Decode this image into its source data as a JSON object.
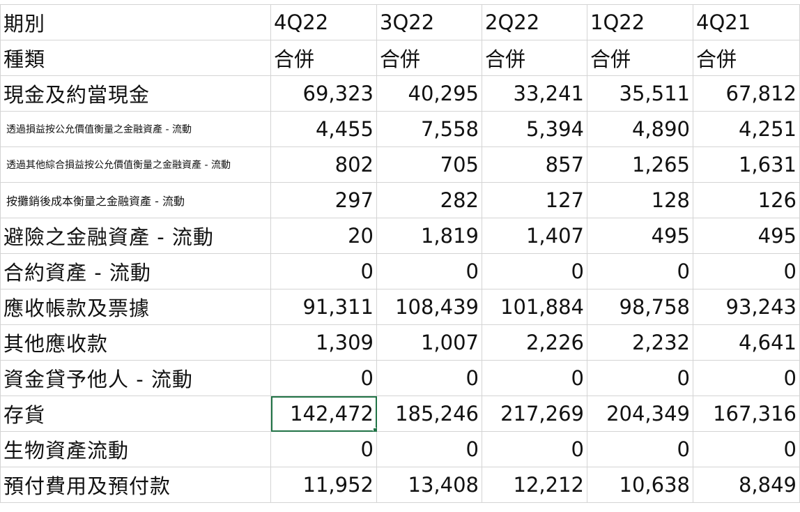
{
  "columns": [
    "期別",
    "4Q22",
    "3Q22",
    "2Q22",
    "1Q22",
    "4Q21"
  ],
  "subheader": [
    "種類",
    "合併",
    "合併",
    "合併",
    "合併",
    "合併"
  ],
  "rows": [
    {
      "label": "現金及約當現金",
      "values": [
        "69,323",
        "40,295",
        "33,241",
        "35,511",
        "67,812"
      ]
    },
    {
      "label": "透過損益按公允價值衡量之金融資產 - 流動",
      "values": [
        "4,455",
        "7,558",
        "5,394",
        "4,890",
        "4,251"
      ]
    },
    {
      "label": "透過其他綜合損益按公允價值衡量之金融資產 - 流動",
      "values": [
        "802",
        "705",
        "857",
        "1,265",
        "1,631"
      ]
    },
    {
      "label": "按攤銷後成本衡量之金融資產 - 流動",
      "values": [
        "297",
        "282",
        "127",
        "128",
        "126"
      ]
    },
    {
      "label": "避險之金融資產 - 流動",
      "values": [
        "20",
        "1,819",
        "1,407",
        "495",
        "495"
      ]
    },
    {
      "label": "合約資產 - 流動",
      "values": [
        "0",
        "0",
        "0",
        "0",
        "0"
      ]
    },
    {
      "label": "應收帳款及票據",
      "values": [
        "91,311",
        "108,439",
        "101,884",
        "98,758",
        "93,243"
      ]
    },
    {
      "label": "其他應收款",
      "values": [
        "1,309",
        "1,007",
        "2,226",
        "2,232",
        "4,641"
      ]
    },
    {
      "label": "資金貸予他人 - 流動",
      "values": [
        "0",
        "0",
        "0",
        "0",
        "0"
      ]
    },
    {
      "label": "存貨",
      "values": [
        "142,472",
        "185,246",
        "217,269",
        "204,349",
        "167,316"
      ]
    },
    {
      "label": "生物資產流動",
      "values": [
        "0",
        "0",
        "0",
        "0",
        "0"
      ]
    },
    {
      "label": "預付費用及預付款",
      "values": [
        "11,952",
        "13,408",
        "12,212",
        "10,638",
        "8,849"
      ]
    }
  ],
  "selected_cell": {
    "row": 9,
    "col": 0
  },
  "colors": {
    "selection": "#217346",
    "gridline": "#d4d4d4"
  }
}
